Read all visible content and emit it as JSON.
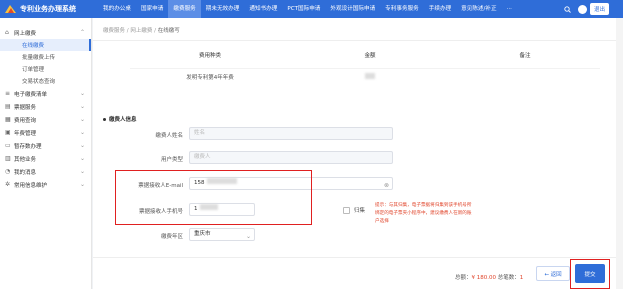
{
  "app": {
    "title": "专利业务办理系统"
  },
  "nav": {
    "items": [
      "我的办公桌",
      "国家申请",
      "缴费服务",
      "期未无效办理",
      "通知书办理",
      "PCT国际申请",
      "外观设计国际申请",
      "专利事务服务",
      "手续办理",
      "意见陈述/补正"
    ],
    "active_index": 2,
    "more": "···"
  },
  "topbar": {
    "search_icon": "search-icon",
    "logout": "退出"
  },
  "sidebar": {
    "groups": [
      {
        "label": "网上缴费",
        "expanded": true,
        "subs": [
          "在线缴费",
          "批量缴费上传",
          "订单管理",
          "交易状态查询"
        ]
      },
      {
        "label": "电子缴费清单"
      },
      {
        "label": "票据服务"
      },
      {
        "label": "费用查询"
      },
      {
        "label": "年费管理"
      },
      {
        "label": "暂存数办理"
      },
      {
        "label": "其他业务"
      },
      {
        "label": "我的消息"
      },
      {
        "label": "常用信息维护"
      }
    ],
    "active_sub": "在线缴费"
  },
  "breadcrumb": {
    "items": [
      "缴费服务",
      "网上缴费",
      "在线缴写"
    ]
  },
  "fee_table": {
    "headers": [
      "费用种类",
      "金额",
      "备注"
    ],
    "rows": [
      [
        "发明专利第4年年费",
        "",
        ""
      ]
    ]
  },
  "section": {
    "title": "缴费人信息"
  },
  "form": {
    "payer_name_label": "缴费人姓名",
    "payer_name_placeholder": "姓名",
    "user_type_label": "用户类型",
    "user_type_placeholder": "缴费人",
    "email_label": "票据接收人E-mail",
    "email_value": "158",
    "phone_label": "票据接收人手机号",
    "phone_value": "1",
    "region_label": "缴费年区",
    "region_value": "重庆市",
    "checkbox_label": "归集",
    "warning": "提示：与其归集，电子票据将归集到该手机号所绑定的电子票夹小程序中，建议缴费人在新的账户选择"
  },
  "footer": {
    "total_label": "总额：",
    "total_value": "¥ 180.00",
    "count_label": "总笔数：",
    "count_value": "1",
    "prev_label": "← 返回",
    "next_label": "提交"
  }
}
